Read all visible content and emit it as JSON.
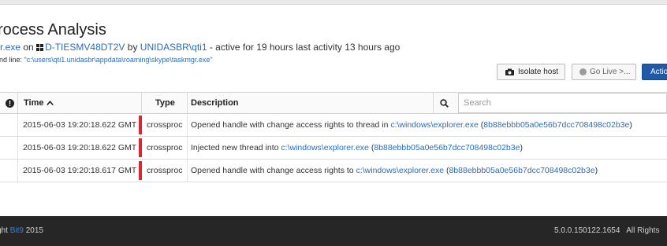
{
  "header": {
    "title": "rocess Analysis",
    "process_name": "r.exe",
    "on_text": "on",
    "host": "D-TIESMV48DT2V",
    "by_text": "by",
    "user": "UNIDASBR\\qti1",
    "activity_text": "- active for 19 hours last activity 13 hours ago",
    "cmd_label": "and line:",
    "cmd_value": "\"c:\\users\\qti1.unidasbr\\appdata\\roaming\\skype\\taskmgr.exe\""
  },
  "toolbar": {
    "isolate_label": "Isolate host",
    "golive_label": "Go Live >...",
    "action_label": "Actio"
  },
  "table": {
    "col_time": "Time",
    "col_type": "Type",
    "col_desc": "Description",
    "search_placeholder": "Search",
    "rows": [
      {
        "time": "2015-06-03 19:20:18.622 GMT",
        "type": "crossproc",
        "desc_pre": "Opened handle with change access rights to thread in ",
        "path": "c:\\windows\\explorer.exe",
        "open": " (",
        "hash": "8b88ebbb05a0e56b7dcc708498c02b3e",
        "close": ")"
      },
      {
        "time": "2015-06-03 19:20:18.622 GMT",
        "type": "crossproc",
        "desc_pre": "Injected new thread into ",
        "path": "c:\\windows\\explorer.exe",
        "open": " (",
        "hash": "8b88ebbb05a0e56b7dcc708498c02b3e",
        "close": ")"
      },
      {
        "time": "2015-06-03 19:20:18.617 GMT",
        "type": "crossproc",
        "desc_pre": "Opened handle with change access rights to ",
        "path": "c:\\windows\\explorer.exe",
        "open": " (",
        "hash": "8b88ebbb05a0e56b7dcc708498c02b3e",
        "close": ")"
      }
    ]
  },
  "footer": {
    "copyright_prefix": "ght",
    "brand": "Bit9",
    "year": "2015",
    "version": "5.0.0.150122.1654",
    "rights": "All Rights"
  },
  "colors": {
    "accent": "#1e5aa8",
    "link": "#2a6db5",
    "row_marker": "#d9282f",
    "footer_bg": "#262626"
  },
  "icons": [
    "windows-icon",
    "camera-icon",
    "status-dot-icon",
    "alert-icon",
    "sort-up-icon",
    "search-icon"
  ]
}
